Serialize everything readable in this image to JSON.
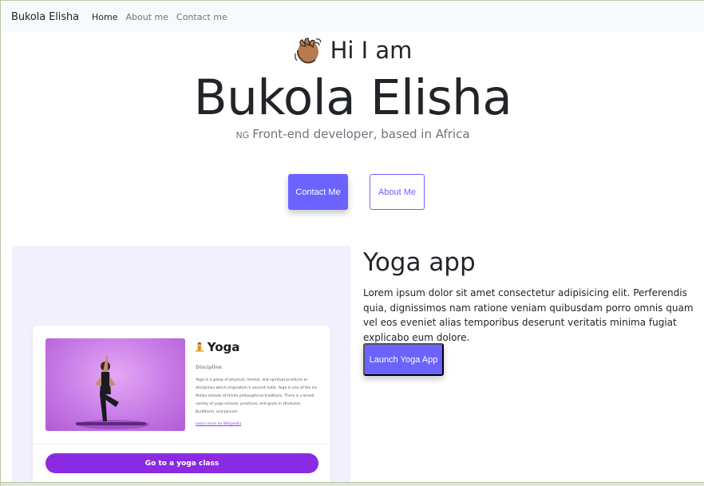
{
  "navbar": {
    "brand": "Bukola Elisha",
    "links": [
      "Home",
      "About me",
      "Contact me"
    ]
  },
  "hero": {
    "greeting": "Hi I am",
    "name": "Bukola Elisha",
    "flag": "NG",
    "tagline": "Front-end developer, based in Africa",
    "primary_button": "Contact Me",
    "secondary_button": "About Me"
  },
  "project": {
    "title": "Yoga app",
    "description": "Lorem ipsum dolor sit amet consectetur adipisicing elit. Perferendis quia, dignissimos nam ratione veniam quibusdam porro omnis quam vel eos eveniet alias temporibus deserunt veritatis minima fugiat explicabo eum dolore.",
    "button": "Launch Yoga App",
    "preview": {
      "title": "Yoga",
      "subtitle": "Discipline",
      "text": "Yoga is a group of physical, mental, and spiritual practices or disciplines which originated in ancient India. Yoga is one of the six Āstika schools of Hindu philosophical traditions. There is a broad variety of yoga schools, practices, and goals in Hinduism, Buddhism, and Jainism.",
      "link": "Learn more on Wikipedia",
      "button": "Go to a yoga class"
    }
  },
  "colors": {
    "accent": "#6c63ff",
    "card_button": "#8a2be2",
    "navbar_bg": "#f8f9fa",
    "panel_bg": "#f3f0fd"
  },
  "icons": {
    "greeting": "waving-hand-icon",
    "preview_title": "person-meditating-icon"
  }
}
